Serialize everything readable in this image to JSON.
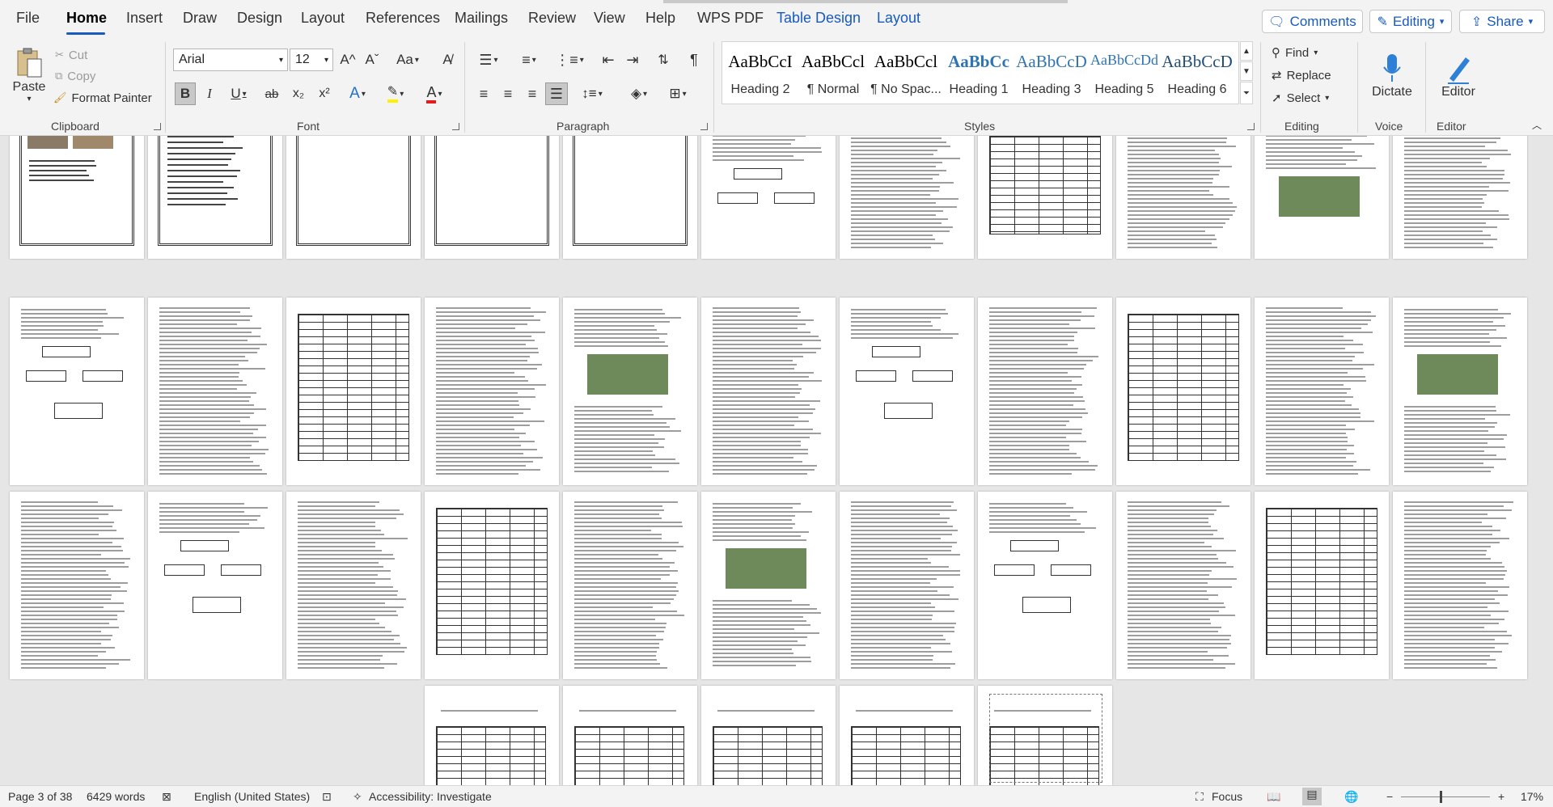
{
  "menu": {
    "tabs": [
      "File",
      "Home",
      "Insert",
      "Draw",
      "Design",
      "Layout",
      "References",
      "Mailings",
      "Review",
      "View",
      "Help",
      "WPS PDF",
      "Table Design",
      "Layout"
    ],
    "active_tab": "Home",
    "comments_label": "Comments",
    "editing_label": "Editing",
    "share_label": "Share"
  },
  "clipboard": {
    "paste_label": "Paste",
    "cut_label": "Cut",
    "copy_label": "Copy",
    "format_painter_label": "Format Painter",
    "group_label": "Clipboard"
  },
  "font": {
    "font_name": "Arial",
    "font_size": "12",
    "change_case_label": "Aa",
    "group_label": "Font",
    "bold": "B",
    "italic": "I",
    "underline": "U",
    "strike": "ab",
    "subscript": "x₂",
    "superscript": "x²",
    "grow": "A^",
    "shrink": "Aˇ"
  },
  "paragraph": {
    "group_label": "Paragraph"
  },
  "styles": {
    "group_label": "Styles",
    "items": [
      {
        "sample": "AaBbCcI",
        "name": "Heading 2"
      },
      {
        "sample": "AaBbCcl",
        "name": "¶ Normal"
      },
      {
        "sample": "AaBbCcl",
        "name": "¶ No Spac..."
      },
      {
        "sample": "AaBbCc",
        "name": "Heading 1"
      },
      {
        "sample": "AaBbCcD",
        "name": "Heading 3"
      },
      {
        "sample": "AaBbCcDd",
        "name": "Heading 5"
      },
      {
        "sample": "AaBbCcD",
        "name": "Heading 6"
      }
    ]
  },
  "editing": {
    "find_label": "Find",
    "replace_label": "Replace",
    "select_label": "Select",
    "group_label": "Editing"
  },
  "voice": {
    "dictate_label": "Dictate",
    "group_label": "Voice"
  },
  "editor": {
    "editor_label": "Editor",
    "group_label": "Editor"
  },
  "status": {
    "page_info": "Page 3 of 38",
    "word_count": "6429 words",
    "language": "English (United States)",
    "accessibility": "Accessibility: Investigate",
    "focus_label": "Focus",
    "zoom_level": "17%",
    "zoom_minus": "−",
    "zoom_plus": "+"
  },
  "colors": {
    "accent": "#185abd",
    "ribbon_bg": "#f3f3f3",
    "canvas_bg": "#e6e6e6",
    "highlight": "#ffef00",
    "font_color": "#e21b1b"
  }
}
